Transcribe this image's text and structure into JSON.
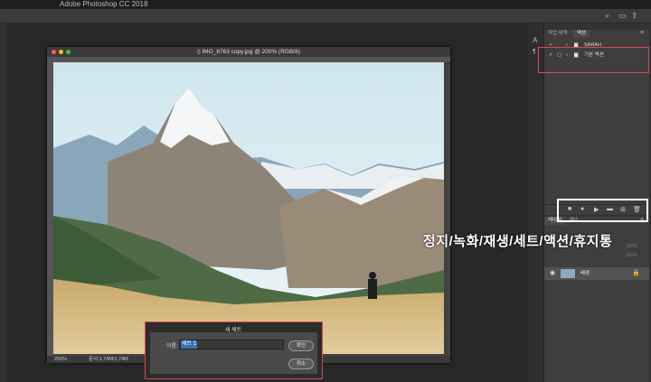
{
  "app": {
    "title": "Adobe Photoshop CC 2018"
  },
  "document": {
    "title": "IMG_6763 copy.jpg @ 200% (RGB/8)",
    "zoom": "200%",
    "doc_info": "문서:1.74M/1.74M"
  },
  "actions_panel": {
    "tabs": [
      "작업 내역",
      "액션"
    ],
    "active_tab": "액션",
    "sets": [
      {
        "name": "SARAH"
      },
      {
        "name": "기본 액션"
      }
    ]
  },
  "layers_panel": {
    "tabs": [
      "레이어",
      "패스"
    ],
    "opacity": "100%",
    "fill": "100%",
    "layer": {
      "name": "배경"
    }
  },
  "dialog": {
    "title": "새 세트",
    "name_label": "이름:",
    "name_value": "세트 1",
    "ok_label": "확인",
    "cancel_label": "취소"
  },
  "annotation": {
    "text": "정지/녹화/재생/세트/액션/휴지통",
    "color": "#d9474c"
  }
}
